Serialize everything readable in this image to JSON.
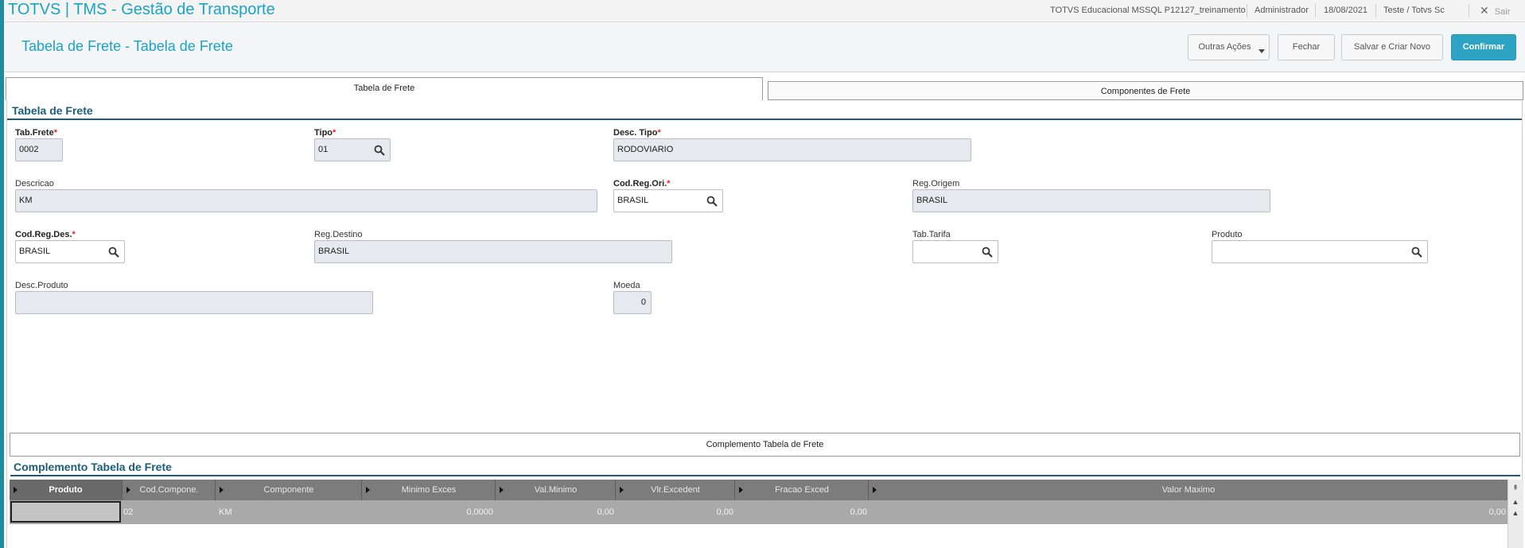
{
  "app": {
    "title": "TOTVS | TMS - Gestão de Transporte"
  },
  "topbar": {
    "environment": "TOTVS Educacional MSSQL P12127_treinamento",
    "user": "Administrador",
    "date": "18/08/2021",
    "company": "Teste / Totvs Sc",
    "exit_label": "Sair"
  },
  "header": {
    "page_title": "Tabela de Frete - Tabela de Frete",
    "buttons": {
      "more_actions": "Outras Ações",
      "close": "Fechar",
      "save_new": "Salvar e Criar Novo",
      "confirm": "Confirmar"
    }
  },
  "tabs": [
    {
      "label": "Tabela de Frete",
      "active": true
    },
    {
      "label": "Componentes de Frete",
      "active": false
    }
  ],
  "form": {
    "section_title": "Tabela de Frete",
    "fields": {
      "tab_frete": {
        "label": "Tab.Frete",
        "required": "*",
        "value": "0002"
      },
      "tipo": {
        "label": "Tipo",
        "required": "*",
        "value": "01"
      },
      "desc_tipo": {
        "label": "Desc. Tipo",
        "required": "*",
        "value": "RODOVIARIO"
      },
      "descricao": {
        "label": "Descricao",
        "value": "KM"
      },
      "cod_reg_ori": {
        "label": "Cod.Reg.Ori.",
        "required": "*",
        "value": "BRASIL"
      },
      "reg_origem": {
        "label": "Reg.Origem",
        "value": "BRASIL"
      },
      "cod_reg_des": {
        "label": "Cod.Reg.Des.",
        "required": "*",
        "value": "BRASIL"
      },
      "reg_destino": {
        "label": "Reg.Destino",
        "value": "BRASIL"
      },
      "tab_tarifa": {
        "label": "Tab.Tarifa",
        "value": ""
      },
      "produto": {
        "label": "Produto",
        "value": ""
      },
      "desc_produto": {
        "label": "Desc.Produto",
        "value": ""
      },
      "moeda": {
        "label": "Moeda",
        "value": "0"
      }
    }
  },
  "complemento": {
    "tab_label": "Complemento Tabela de Frete",
    "section_title": "Complemento Tabela de Frete",
    "columns": [
      "Produto",
      "Cod.Compone.",
      "Componente",
      "Minimo Exces",
      "Val.Minimo",
      "Vlr.Excedent",
      "Fracao Exced",
      "Valor Maximo"
    ],
    "rows": [
      {
        "produto": "",
        "cod_compone": "02",
        "componente": "KM",
        "minimo_exces": "0,0000",
        "val_minimo": "0,00",
        "vlr_excedent": "0,00",
        "fracao_exced": "0,00",
        "valor_maximo": "0,00"
      }
    ]
  },
  "colors": {
    "brand": "#1aa3c4",
    "primary_button": "#2ea4c4",
    "section": "#1c5d7a",
    "required": "#d62b2b"
  },
  "icons": [
    "search-icon",
    "close-icon",
    "caret-down-icon",
    "scroll-top-icon",
    "scroll-up-icon",
    "scroll-down-icon"
  ]
}
